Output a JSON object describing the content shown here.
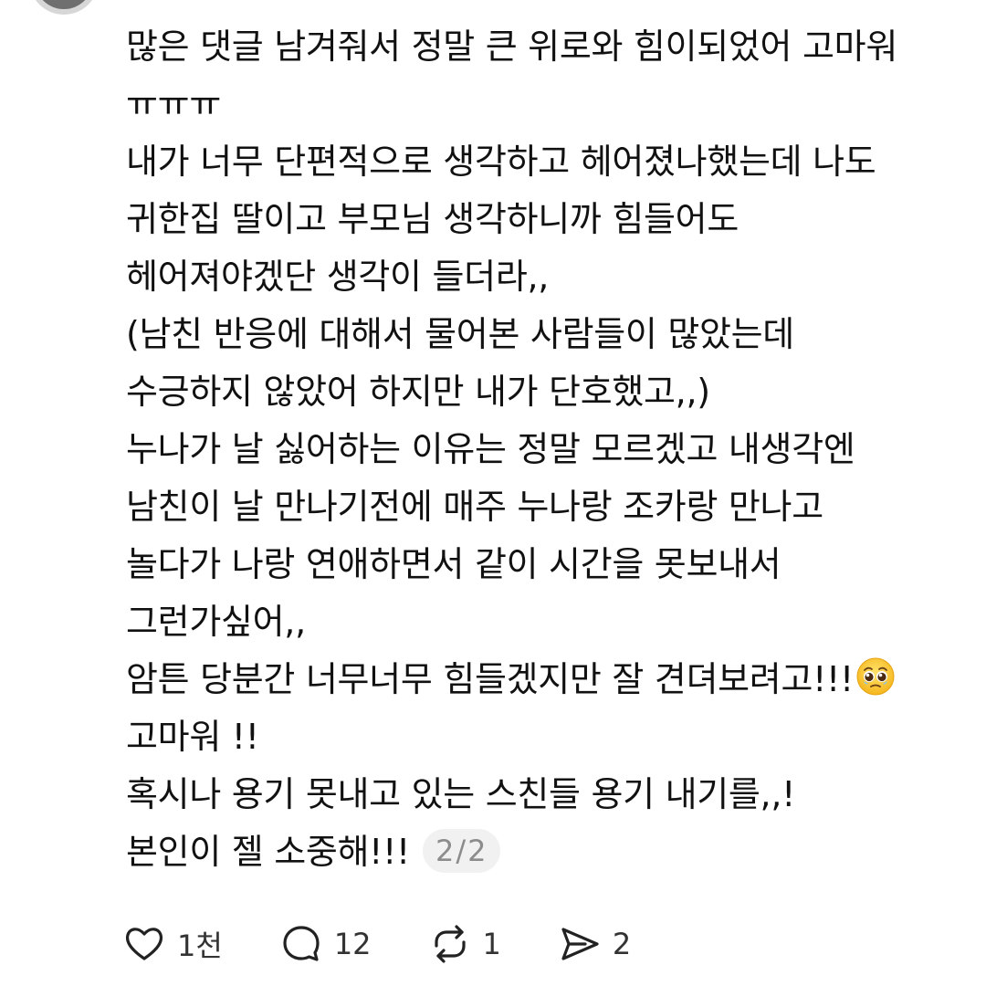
{
  "post": {
    "lines": [
      "많은 댓글 남겨줘서 정말 큰 위로와 힘이되었어 고마워",
      "ㅠㅠㅠ",
      "내가 너무 단편적으로 생각하고 헤어졌나했는데 나도",
      "귀한집 딸이고 부모님 생각하니까 힘들어도",
      "헤어져야겠단 생각이 들더라,,",
      "(남친 반응에 대해서 물어본 사람들이 많았는데",
      "수긍하지 않았어 하지만 내가 단호했고,,)",
      "누나가 날 싫어하는 이유는 정말 모르겠고 내생각엔",
      "남친이 날 만나기전에 매주 누나랑 조카랑 만나고",
      "놀다가 나랑 연애하면서 같이 시간을 못보내서",
      "그런가싶어,,",
      "암튼 당분간 너무너무 힘들겠지만 잘 견뎌보려고!!!",
      "고마워 !!",
      "혹시나 용기 못내고 있는 스친들 용기 내기를,,!",
      "본인이 젤 소중해!!!"
    ],
    "emoji": "pleading-face-emoji",
    "page_indicator": "2/2"
  },
  "actions": {
    "like_count": "1천",
    "reply_count": "12",
    "repost_count": "1",
    "share_count": "2"
  },
  "icons": {
    "like": "heart-icon",
    "reply": "speech-bubble-icon",
    "repost": "repost-icon",
    "share": "send-icon"
  },
  "colors": {
    "text": "#111111",
    "muted": "#8c8c8c",
    "badge_bg": "#f1f1f1",
    "icon": "#222222"
  }
}
